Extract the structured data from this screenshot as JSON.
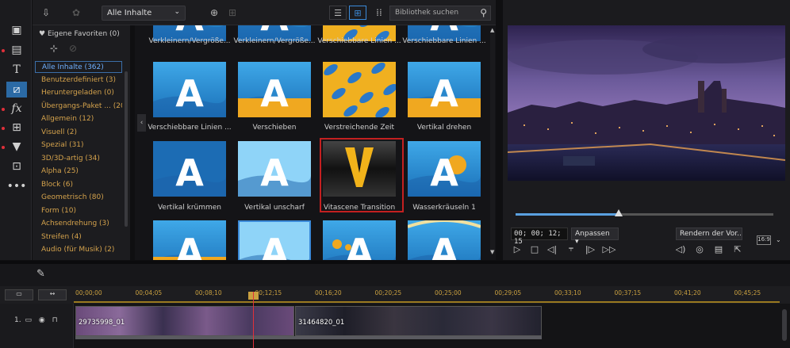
{
  "header": {
    "filter_value": "Alle Inhalte",
    "search_placeholder": "Bibliothek suchen"
  },
  "sidebar": {
    "favorites": "Eigene Favoriten (0)",
    "categories": [
      "Alle Inhalte (362)",
      "Benutzerdefiniert (3)",
      "Heruntergeladen (0)",
      "Übergangs-Paket ... (20)",
      "Allgemein (12)",
      "Visuell (2)",
      "Spezial (31)",
      "3D/3D-artig (34)",
      "Alpha (25)",
      "Block (6)",
      "Geometrisch (80)",
      "Form (10)",
      "Achsendrehung (3)",
      "Streifen (4)",
      "Audio (für Musik) (2)"
    ]
  },
  "grid": {
    "captions": [
      "Verkleinern/Vergröße...",
      "Verkleinern/Vergröße...",
      "Verschiebbare Linien ...",
      "Verschiebbare Linien ...",
      "Verschiebbare Linien ...",
      "Verschieben",
      "Verstreichende Zeit",
      "Vertikal drehen",
      "Vertikal krümmen",
      "Vertikal unscharf",
      "Vitascene Transition",
      "Wasserkräuseln 1"
    ],
    "tile_letter": "A",
    "vitascene_letter": "V"
  },
  "preview": {
    "timecode": "00; 00; 12; 15",
    "fit": "Anpassen",
    "render": "Rendern der Vor...",
    "ratio": "16:9",
    "position_fraction": 0.4
  },
  "timeline": {
    "ruler": [
      "00;00;00",
      "00;04;05",
      "00;08;10",
      "00;12;15",
      "00;16;20",
      "00;20;25",
      "00;25;00",
      "00;29;05",
      "00;33;10",
      "00;37;15",
      "00;41;20",
      "00;45;25"
    ],
    "track_label": "1.",
    "clips": [
      "29735998_01",
      "31464820_01"
    ]
  },
  "colors": {
    "accent": "#3b8ad9",
    "category": "#d4a24c",
    "playhead": "#e0303a",
    "selection": "#c42020"
  }
}
